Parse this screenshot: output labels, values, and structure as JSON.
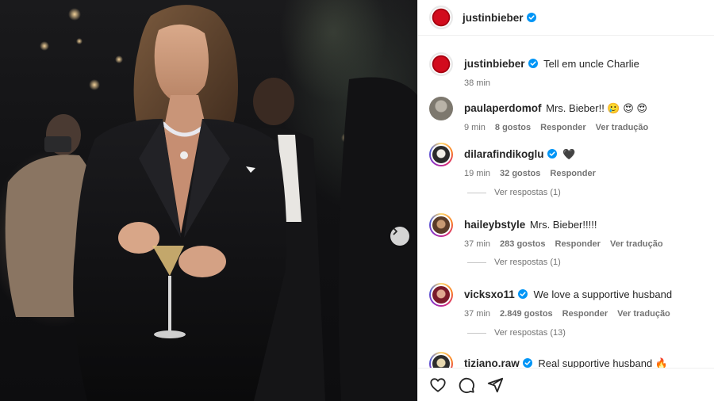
{
  "post": {
    "author": "justinbieber",
    "caption": "Tell em uncle Charlie",
    "caption_time": "38 min"
  },
  "comments": [
    {
      "user": "paulaperdomof",
      "verified": false,
      "text": "Mrs. Bieber!! 🥲 😍 😍",
      "time": "9 min",
      "likes": "8 gostos",
      "reply": "Responder",
      "translate": "Ver tradução",
      "replies": ""
    },
    {
      "user": "dilarafindikoglu",
      "verified": true,
      "text": "🖤",
      "time": "19 min",
      "likes": "32 gostos",
      "reply": "Responder",
      "translate": "",
      "replies": "Ver respostas (1)"
    },
    {
      "user": "haileybstyle",
      "verified": false,
      "text": "Mrs. Bieber!!!!!",
      "time": "37 min",
      "likes": "283 gostos",
      "reply": "Responder",
      "translate": "Ver tradução",
      "replies": "Ver respostas (1)"
    },
    {
      "user": "vicksxo11",
      "verified": true,
      "text": "We love a supportive husband",
      "time": "37 min",
      "likes": "2.849 gostos",
      "reply": "Responder",
      "translate": "Ver tradução",
      "replies": "Ver respostas (13)"
    },
    {
      "user": "tiziano.raw",
      "verified": true,
      "text": "Real supportive husband 🔥",
      "time": "",
      "likes": "",
      "reply": "",
      "translate": "",
      "replies": ""
    }
  ],
  "icons": {
    "verified": "verified-badge-icon",
    "next": "chevron-right-icon",
    "like": "heart-icon",
    "comment": "comment-bubble-icon",
    "share": "paper-plane-icon"
  },
  "colors": {
    "verified": "#0095f6",
    "text": "#262626",
    "muted": "#737373",
    "avatar_red": "#d20b1d"
  }
}
